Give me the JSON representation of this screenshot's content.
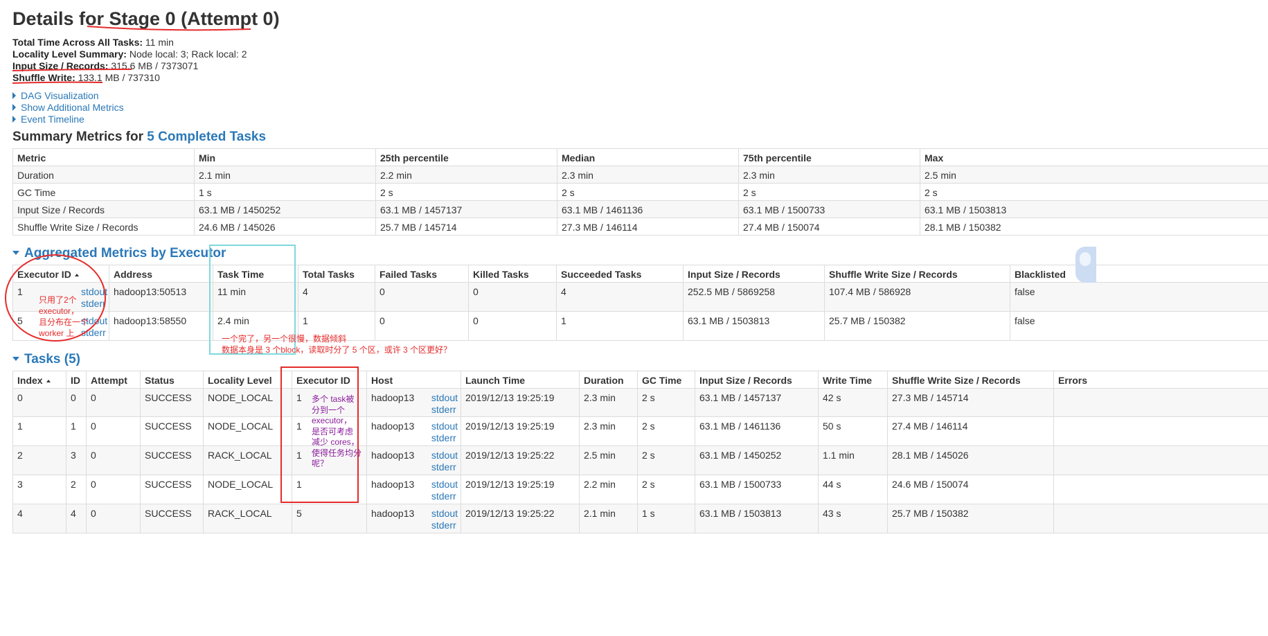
{
  "title": "Details for Stage 0 (Attempt 0)",
  "summary": [
    {
      "label": "Total Time Across All Tasks:",
      "value": "11 min"
    },
    {
      "label": "Locality Level Summary:",
      "value": "Node local: 3; Rack local: 2"
    },
    {
      "label": "Input Size / Records:",
      "value": "315.6 MB / 7373071"
    },
    {
      "label": "Shuffle Write:",
      "value": "133.1 MB / 737310"
    }
  ],
  "links": [
    "DAG Visualization",
    "Show Additional Metrics",
    "Event Timeline"
  ],
  "summary_metrics": {
    "heading_prefix": "Summary Metrics for ",
    "heading_link": "5 Completed Tasks",
    "columns": [
      "Metric",
      "Min",
      "25th percentile",
      "Median",
      "75th percentile",
      "Max"
    ],
    "rows": [
      [
        "Duration",
        "2.1 min",
        "2.2 min",
        "2.3 min",
        "2.3 min",
        "2.5 min"
      ],
      [
        "GC Time",
        "1 s",
        "2 s",
        "2 s",
        "2 s",
        "2 s"
      ],
      [
        "Input Size / Records",
        "63.1 MB / 1450252",
        "63.1 MB / 1457137",
        "63.1 MB / 1461136",
        "63.1 MB / 1500733",
        "63.1 MB / 1503813"
      ],
      [
        "Shuffle Write Size / Records",
        "24.6 MB / 145026",
        "25.7 MB / 145714",
        "27.3 MB / 146114",
        "27.4 MB / 150074",
        "28.1 MB / 150382"
      ]
    ]
  },
  "aggregated": {
    "heading": "Aggregated Metrics by Executor",
    "columns": [
      "Executor ID",
      "Address",
      "Task Time",
      "Total Tasks",
      "Failed Tasks",
      "Killed Tasks",
      "Succeeded Tasks",
      "Input Size / Records",
      "Shuffle Write Size / Records",
      "Blacklisted"
    ],
    "rows": [
      {
        "id": "1",
        "stdout": "stdout",
        "stderr": "stderr",
        "address": "hadoop13:50513",
        "task_time": "11 min",
        "total": "4",
        "failed": "0",
        "killed": "0",
        "succeeded": "4",
        "input": "252.5 MB / 5869258",
        "shuffle": "107.4 MB / 586928",
        "blacklisted": "false"
      },
      {
        "id": "5",
        "stdout": "stdout",
        "stderr": "stderr",
        "address": "hadoop13:58550",
        "task_time": "2.4 min",
        "total": "1",
        "failed": "0",
        "killed": "0",
        "succeeded": "1",
        "input": "63.1 MB / 1503813",
        "shuffle": "25.7 MB / 150382",
        "blacklisted": "false"
      }
    ]
  },
  "tasks": {
    "heading": "Tasks (5)",
    "columns": [
      "Index",
      "ID",
      "Attempt",
      "Status",
      "Locality Level",
      "Executor ID",
      "Host",
      "Launch Time",
      "Duration",
      "GC Time",
      "Input Size / Records",
      "Write Time",
      "Shuffle Write Size / Records",
      "Errors"
    ],
    "rows": [
      {
        "index": "0",
        "id": "0",
        "attempt": "0",
        "status": "SUCCESS",
        "locality": "NODE_LOCAL",
        "executor": "1",
        "host": "hadoop13",
        "stdout": "stdout",
        "stderr": "stderr",
        "launch": "2019/12/13 19:25:19",
        "duration": "2.3 min",
        "gc": "2 s",
        "input": "63.1 MB / 1457137",
        "write_time": "42 s",
        "shuffle": "27.3 MB / 145714"
      },
      {
        "index": "1",
        "id": "1",
        "attempt": "0",
        "status": "SUCCESS",
        "locality": "NODE_LOCAL",
        "executor": "1",
        "host": "hadoop13",
        "stdout": "stdout",
        "stderr": "stderr",
        "launch": "2019/12/13 19:25:19",
        "duration": "2.3 min",
        "gc": "2 s",
        "input": "63.1 MB / 1461136",
        "write_time": "50 s",
        "shuffle": "27.4 MB / 146114"
      },
      {
        "index": "2",
        "id": "3",
        "attempt": "0",
        "status": "SUCCESS",
        "locality": "RACK_LOCAL",
        "executor": "1",
        "host": "hadoop13",
        "stdout": "stdout",
        "stderr": "stderr",
        "launch": "2019/12/13 19:25:22",
        "duration": "2.5 min",
        "gc": "2 s",
        "input": "63.1 MB / 1450252",
        "write_time": "1.1 min",
        "shuffle": "28.1 MB / 145026"
      },
      {
        "index": "3",
        "id": "2",
        "attempt": "0",
        "status": "SUCCESS",
        "locality": "NODE_LOCAL",
        "executor": "1",
        "host": "hadoop13",
        "stdout": "stdout",
        "stderr": "stderr",
        "launch": "2019/12/13 19:25:19",
        "duration": "2.2 min",
        "gc": "2 s",
        "input": "63.1 MB / 1500733",
        "write_time": "44 s",
        "shuffle": "24.6 MB / 150074"
      },
      {
        "index": "4",
        "id": "4",
        "attempt": "0",
        "status": "SUCCESS",
        "locality": "RACK_LOCAL",
        "executor": "5",
        "host": "hadoop13",
        "stdout": "stdout",
        "stderr": "stderr",
        "launch": "2019/12/13 19:25:22",
        "duration": "2.1 min",
        "gc": "1 s",
        "input": "63.1 MB / 1503813",
        "write_time": "43 s",
        "shuffle": "25.7 MB / 150382"
      }
    ]
  },
  "annotations": {
    "executor_note": [
      "只用了2个",
      "executor，",
      "且分布在一个",
      "worker 上"
    ],
    "task_time_note": [
      "一个完了，另一个很慢，数据倾斜",
      "数据本身是 3 个block，读取时分了 5 个区，或许 3 个区更好？"
    ],
    "executor_id_note": [
      "多个 task被",
      "分到一个",
      "executor，",
      "是否可考虑",
      "减少 cores，",
      "使得任务均分",
      "呢？"
    ]
  },
  "colors": {
    "link": "#2a78b8",
    "annotation_red": "#e52b2b",
    "annotation_purple": "#8a1c9c",
    "annotation_cyan": "#7fd8dc"
  }
}
